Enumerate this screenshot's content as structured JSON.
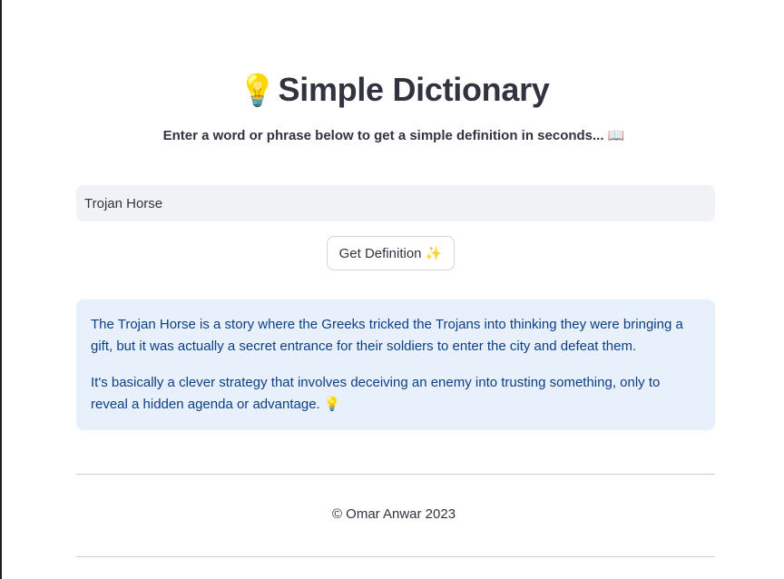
{
  "header": {
    "icon": "lightbulb-icon",
    "icon_glyph": "💡",
    "title": "Simple Dictionary",
    "subtitle": "Enter a word or phrase below to get a simple definition in seconds... 📖"
  },
  "search": {
    "value": "Trojan Horse",
    "placeholder": ""
  },
  "button": {
    "label": "Get Definition ✨"
  },
  "result": {
    "paragraphs": [
      "The Trojan Horse is a story where the Greeks tricked the Trojans into thinking they were bringing a gift, but it was actually a secret entrance for their soldiers to enter the city and defeat them.",
      "It's basically a clever strategy that involves deceiving an enemy into trusting something, only to reveal a hidden agenda or advantage. 💡"
    ]
  },
  "footer": {
    "text": "© Omar Anwar 2023"
  },
  "colors": {
    "input_bg": "#f0f2f6",
    "result_bg": "#e8f0fb",
    "result_text": "#0d3f86",
    "text": "#31333f"
  }
}
